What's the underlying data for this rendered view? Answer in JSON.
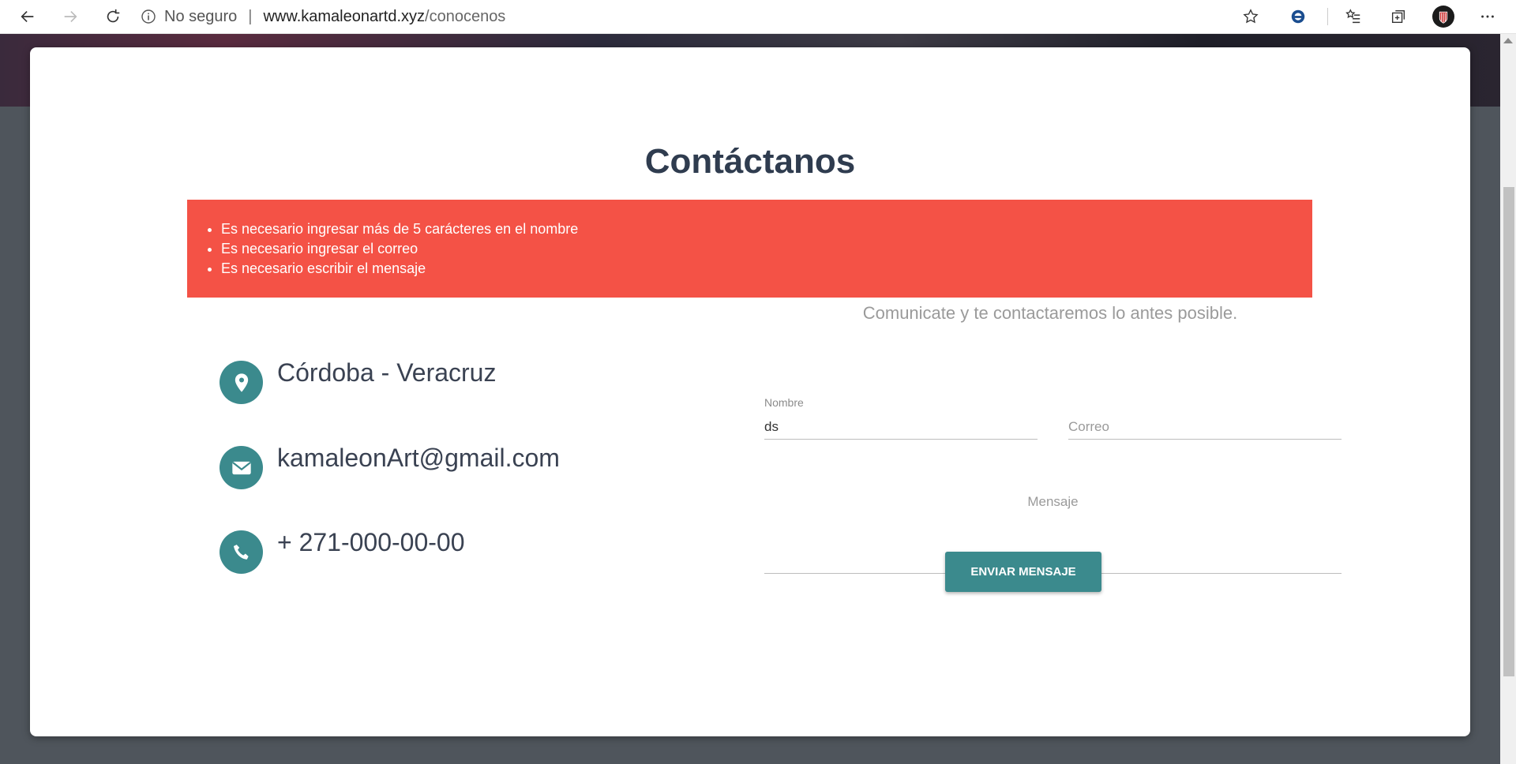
{
  "browser": {
    "security_label": "No seguro",
    "url_host": "www.kamaleonartd.xyz",
    "url_path": "/conocenos"
  },
  "contact": {
    "title": "Contáctanos",
    "errors": [
      "Es necesario ingresar más de 5 carácteres en el nombre",
      "Es necesario ingresar el correo",
      "Es necesario escribir el mensaje"
    ],
    "location": "Córdoba - Veracruz",
    "email": "kamaleonArt@gmail.com",
    "phone": "+ 271-000-00-00"
  },
  "form": {
    "intro": "Comunicate y te contactaremos lo antes posible.",
    "name_label": "Nombre",
    "name_value": "ds",
    "email_placeholder": "Correo",
    "message_placeholder": "Mensaje",
    "submit_label": "ENVIAR MENSAJE"
  },
  "colors": {
    "accent": "#3b8a8d",
    "error": "#f45246",
    "title": "#2f3c4f"
  }
}
